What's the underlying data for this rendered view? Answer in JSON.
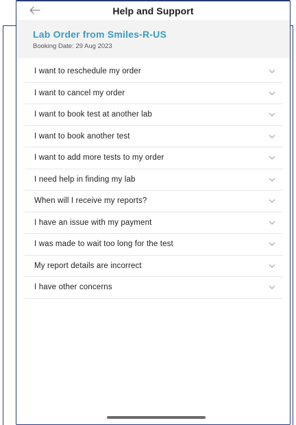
{
  "header": {
    "title": "Help and Support",
    "back_icon": "arrow-left-icon"
  },
  "order": {
    "title": "Lab Order from Smiles-R-US",
    "booking_date": "Booking Date: 29 Aug 2023",
    "accent_color": "#3a9bc4"
  },
  "issues": [
    {
      "label": "I want to reschedule my order"
    },
    {
      "label": "I want to cancel my order"
    },
    {
      "label": "I want to book test at another lab"
    },
    {
      "label": "I want to book another test"
    },
    {
      "label": "I want to add more tests to my order"
    },
    {
      "label": "I need help in finding my lab"
    },
    {
      "label": "When will I receive my reports?"
    },
    {
      "label": "I have an issue with my payment"
    },
    {
      "label": "I was made to wait too long for the test"
    },
    {
      "label": "My report details are incorrect"
    },
    {
      "label": "I have other concerns"
    }
  ],
  "icons": {
    "expand": "chevron-down-icon"
  }
}
